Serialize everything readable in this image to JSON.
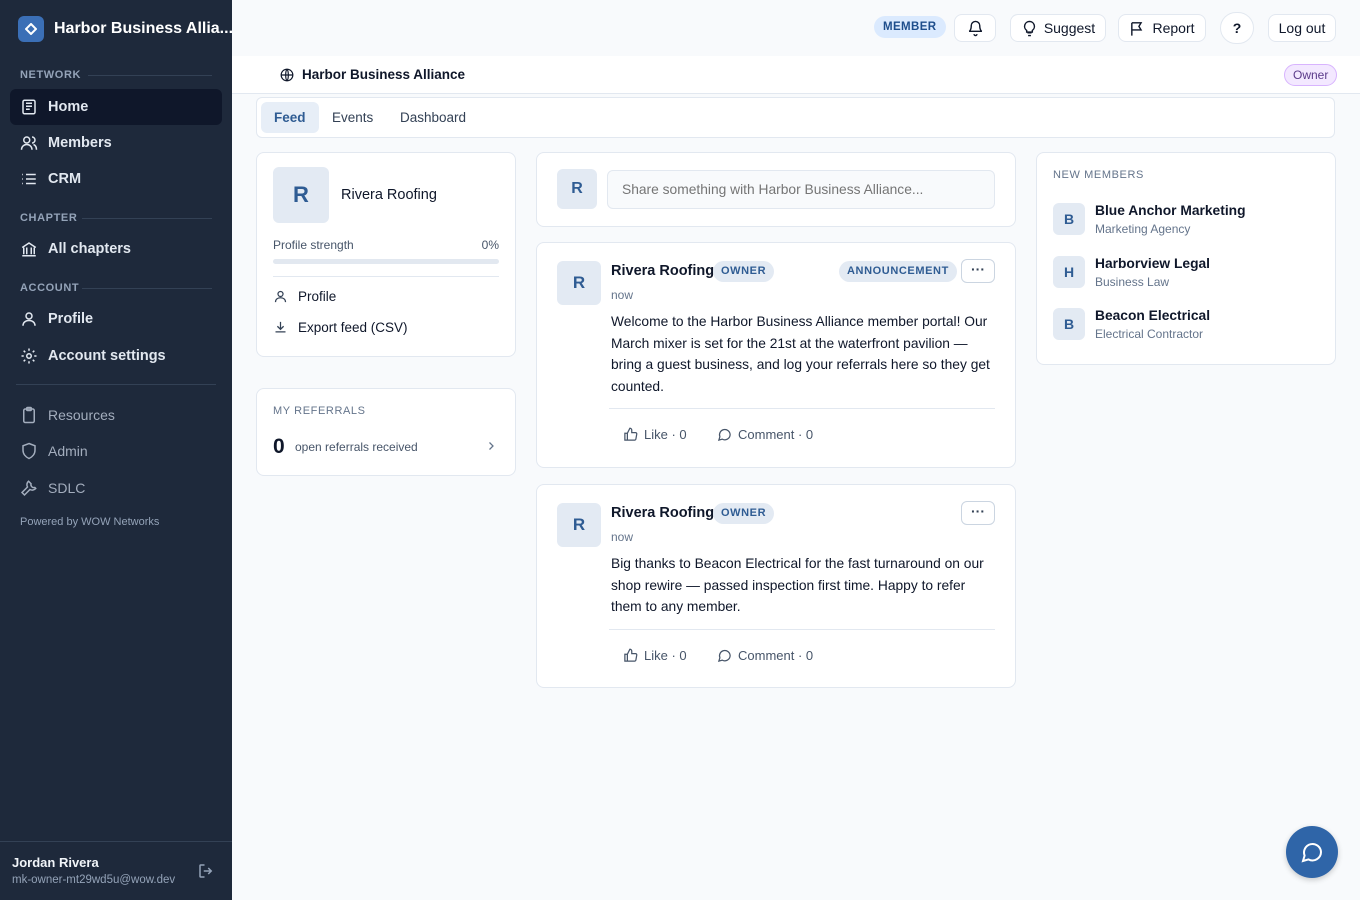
{
  "sidebar": {
    "brand": "Harbor Business Allia...",
    "sections": {
      "network": "NETWORK",
      "chapter": "CHAPTER",
      "account": "ACCOUNT"
    },
    "items": {
      "home": "Home",
      "members": "Members",
      "crm": "CRM",
      "all_chapters": "All chapters",
      "profile": "Profile",
      "account_settings": "Account settings",
      "resources": "Resources",
      "admin": "Admin",
      "sdlc": "SDLC"
    },
    "powered_by": "Powered by WOW Networks",
    "user": {
      "name": "Jordan Rivera",
      "email": "mk-owner-mt29wd5u@wow.dev"
    }
  },
  "topbar": {
    "role_badge": "MEMBER",
    "suggest": "Suggest",
    "report": "Report",
    "help": "?",
    "logout": "Log out"
  },
  "subheader": {
    "network_name": "Harbor Business Alliance",
    "role_pill": "Owner"
  },
  "tabs": {
    "feed": "Feed",
    "events": "Events",
    "dashboard": "Dashboard",
    "active": "Feed"
  },
  "profile_card": {
    "avatar_letter": "R",
    "name": "Rivera Roofing",
    "strength_label": "Profile strength",
    "strength_value": "0%",
    "strength_fraction": 0,
    "profile_link": "Profile",
    "export_link": "Export feed (CSV)"
  },
  "referrals_card": {
    "title": "MY REFERRALS",
    "count": "0",
    "label": "open referrals received"
  },
  "composer": {
    "avatar_letter": "R",
    "placeholder": "Share something with Harbor Business Alliance..."
  },
  "posts": [
    {
      "avatar_letter": "R",
      "author": "Rivera Roofing",
      "role": "OWNER",
      "tag": "ANNOUNCEMENT",
      "time": "now",
      "body": "Welcome to the Harbor Business Alliance member portal! Our March mixer is set for the 21st at the waterfront pavilion — bring a guest business, and log your referrals here so they get counted.",
      "like": "Like · 0",
      "comment": "Comment · 0",
      "more": "···"
    },
    {
      "avatar_letter": "R",
      "author": "Rivera Roofing",
      "role": "OWNER",
      "time": "now",
      "body": "Big thanks to Beacon Electrical for the fast turnaround on our shop rewire — passed inspection first time. Happy to refer them to any member.",
      "like": "Like · 0",
      "comment": "Comment · 0",
      "more": "···"
    }
  ],
  "new_members": {
    "title": "NEW MEMBERS",
    "items": [
      {
        "letter": "B",
        "name": "Blue Anchor Marketing",
        "category": "Marketing Agency"
      },
      {
        "letter": "H",
        "name": "Harborview Legal",
        "category": "Business Law"
      },
      {
        "letter": "B",
        "name": "Beacon Electrical",
        "category": "Electrical Contractor"
      }
    ]
  },
  "colors": {
    "sidebar_bg": "#1e293b",
    "accent": "#2f5c93",
    "fab": "#2f65a8"
  }
}
